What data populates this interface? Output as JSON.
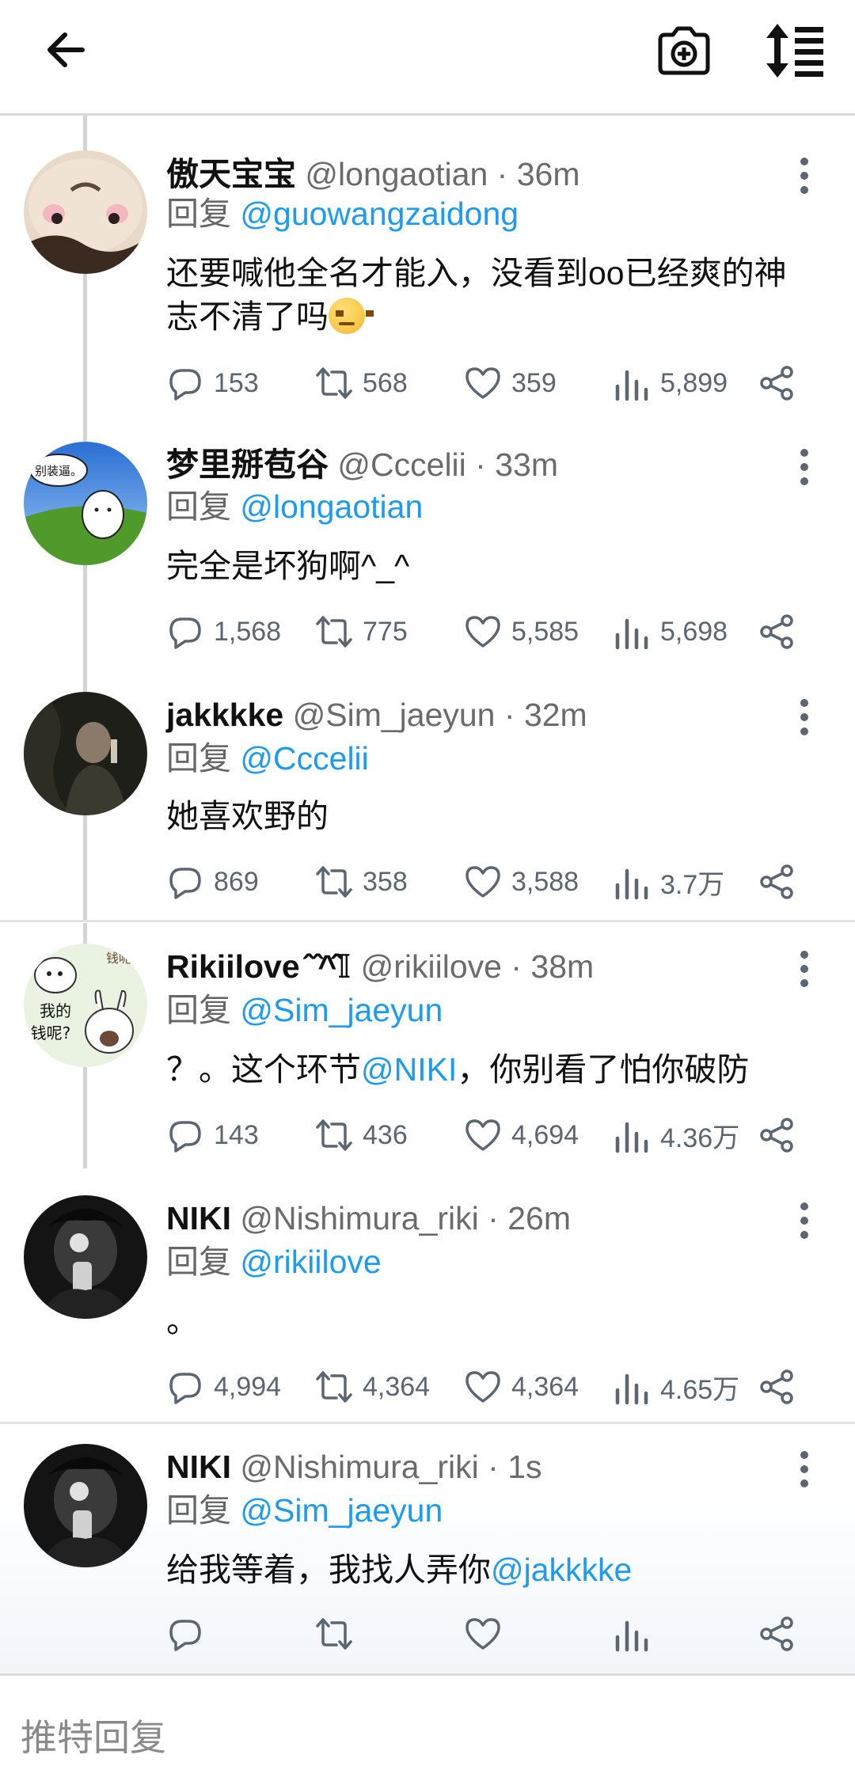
{
  "topbar": {
    "back_icon": "arrow-left-icon",
    "camera_icon": "camera-plus-icon",
    "sort_icon": "sort-thread-icon"
  },
  "reply_label": "回复",
  "tweets": [
    {
      "name": "傲天宝宝",
      "handle": "@longaotian",
      "dot": "·",
      "time": "36m",
      "reply_to": "@guowangzaidong",
      "text_line1": "还要喊他全名才能入，没看到oo已经爽的神",
      "text_line2": "志不清了吗",
      "emoji": "angry-face-emoji",
      "replies": "153",
      "retweets": "568",
      "likes": "359",
      "views": "5,899"
    },
    {
      "name": "梦里掰苞谷",
      "handle": "@Cccelii",
      "dot": "·",
      "time": "33m",
      "reply_to": "@longaotian",
      "text": "完全是坏狗啊^_^",
      "avatar_text": "别装逼。",
      "replies": "1,568",
      "retweets": "775",
      "likes": "5,585",
      "views": "5,698"
    },
    {
      "name": "jakkkke",
      "handle": "@Sim_jaeyun",
      "dot": "·",
      "time": "32m",
      "reply_to": "@Cccelii",
      "text": "她喜欢野的",
      "replies": "869",
      "retweets": "358",
      "likes": "3,588",
      "views": "3.7万"
    },
    {
      "name": "Rikiilove ̂ ̂^̂̂𝕀",
      "handle": "@rikiilove",
      "dot": "·",
      "time": "38m",
      "reply_to": "@Sim_jaeyun",
      "text_pre": "？。这个环节",
      "mention": "@NIKI",
      "text_post": "，你别看了怕你破防",
      "avatar_text1": "我的",
      "avatar_text2": "钱呢?",
      "avatar_text3": "钱呢",
      "replies": "143",
      "retweets": "436",
      "likes": "4,694",
      "views": "4.36万"
    },
    {
      "name": "NIKI",
      "handle": "@Nishimura_riki",
      "dot": "·",
      "time": "26m",
      "reply_to": "@rikiilove",
      "text": "。",
      "replies": "4,994",
      "retweets": "4,364",
      "likes": "4,364",
      "views": "4.65万"
    },
    {
      "name": "NIKI",
      "handle": "@Nishimura_riki",
      "dot": "·",
      "time": "1s",
      "reply_to": "@Sim_jaeyun",
      "text_pre": "给我等着，我找人弄你",
      "mention": "@jakkkke",
      "replies": "",
      "retweets": "",
      "likes": "",
      "views": ""
    }
  ],
  "compose": {
    "placeholder": "推特回复"
  },
  "colors": {
    "link": "#1d9bf0",
    "muted": "#6b6b6b",
    "icon": "#5b6670"
  }
}
